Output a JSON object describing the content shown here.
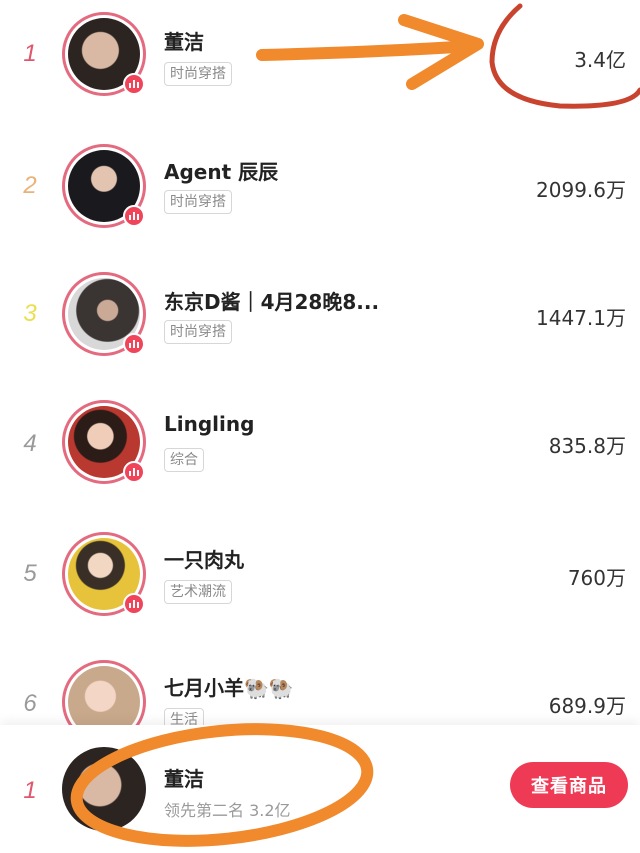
{
  "rows": [
    {
      "rank": "1",
      "name": "董洁",
      "tag": "时尚穿搭",
      "value": "3.4亿",
      "rank_color": "#e0566c"
    },
    {
      "rank": "2",
      "name": "Agent 辰辰",
      "tag": "时尚穿搭",
      "value": "2099.6万",
      "rank_color": "#e9b27a"
    },
    {
      "rank": "3",
      "name": "东京D酱｜4月28晚8...",
      "tag": "时尚穿搭",
      "value": "1447.1万",
      "rank_color": "#eadf4f"
    },
    {
      "rank": "4",
      "name": "Lingling",
      "tag": "综合",
      "value": "835.8万",
      "rank_color": "#9a9a9a"
    },
    {
      "rank": "5",
      "name": "一只肉丸",
      "tag": "艺术潮流",
      "value": "760万",
      "rank_color": "#9a9a9a"
    },
    {
      "rank": "6",
      "name": "七月小羊🐏🐏",
      "tag": "生活",
      "value": "689.9万",
      "rank_color": "#9a9a9a"
    }
  ],
  "self_row": {
    "rank": "1",
    "name": "董洁",
    "subtitle": "领先第二名 3.2亿",
    "button": "查看商品"
  },
  "colors": {
    "accent": "#ef3a56",
    "annotation": "#f08a2c",
    "circle_mark": "#c9442f"
  }
}
